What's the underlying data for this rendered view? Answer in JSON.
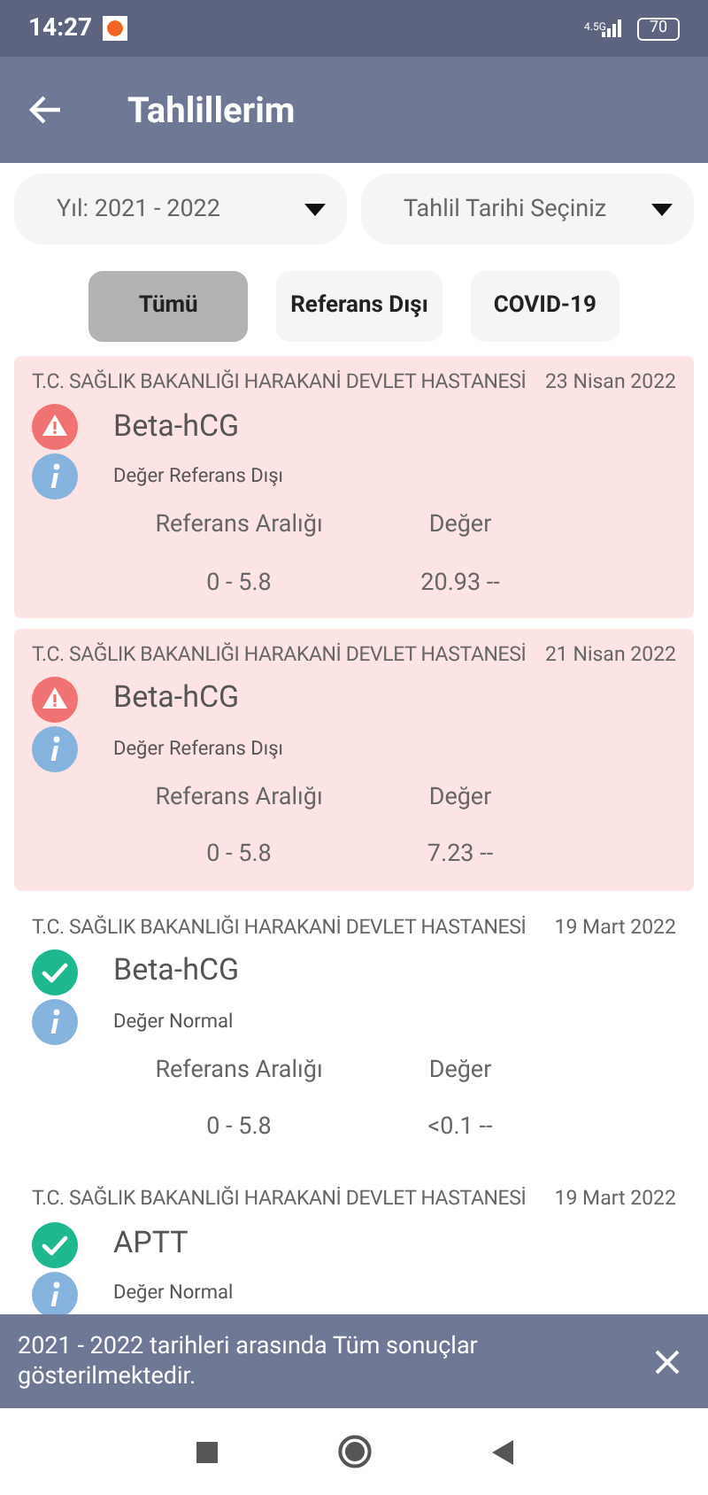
{
  "status_bar": {
    "time": "14:27",
    "network": "4.5G",
    "battery": "70"
  },
  "header": {
    "title": "Tahlillerim"
  },
  "dropdowns": [
    {
      "value": "Yıl: 2021 - 2022"
    },
    {
      "value": "Tahlil Tarihi Seçiniz"
    }
  ],
  "filters": [
    {
      "label": "Tümü",
      "selected": true
    },
    {
      "label": "Referans Dışı",
      "selected": false
    },
    {
      "label": "COVID-19",
      "selected": false
    }
  ],
  "results": [
    {
      "kind": "abnormal",
      "hospital": "T.C. SAĞLIK BAKANLIĞI HARAKANİ DEVLET HASTANESİ",
      "date": "23 Nisan 2022",
      "test": "Beta-hCG",
      "status": "Değer Referans Dışı",
      "range_label": "Referans Aralığı",
      "value_label": "Değer",
      "range": "0 - 5.8",
      "value": "20.93 --"
    },
    {
      "kind": "abnormal",
      "hospital": "T.C. SAĞLIK BAKANLIĞI HARAKANİ DEVLET HASTANESİ",
      "date": "21 Nisan 2022",
      "test": "Beta-hCG",
      "status": "Değer Referans Dışı",
      "range_label": "Referans Aralığı",
      "value_label": "Değer",
      "range": "0 - 5.8",
      "value": "7.23 --"
    },
    {
      "kind": "normal",
      "hospital": "T.C. SAĞLIK BAKANLIĞI HARAKANİ DEVLET HASTANESİ",
      "date": "19 Mart 2022",
      "test": "Beta-hCG",
      "status": "Değer Normal",
      "range_label": "Referans Aralığı",
      "value_label": "Değer",
      "range": "0 - 5.8",
      "value": "<0.1 --"
    },
    {
      "kind": "normal",
      "hospital": "T.C. SAĞLIK BAKANLIĞI HARAKANİ DEVLET HASTANESİ",
      "date": "19 Mart 2022",
      "test": "APTT",
      "status": "Değer Normal"
    }
  ],
  "snackbar": {
    "message": "2021 - 2022 tarihleri arasında Tüm sonuçlar gösterilmektedir."
  }
}
